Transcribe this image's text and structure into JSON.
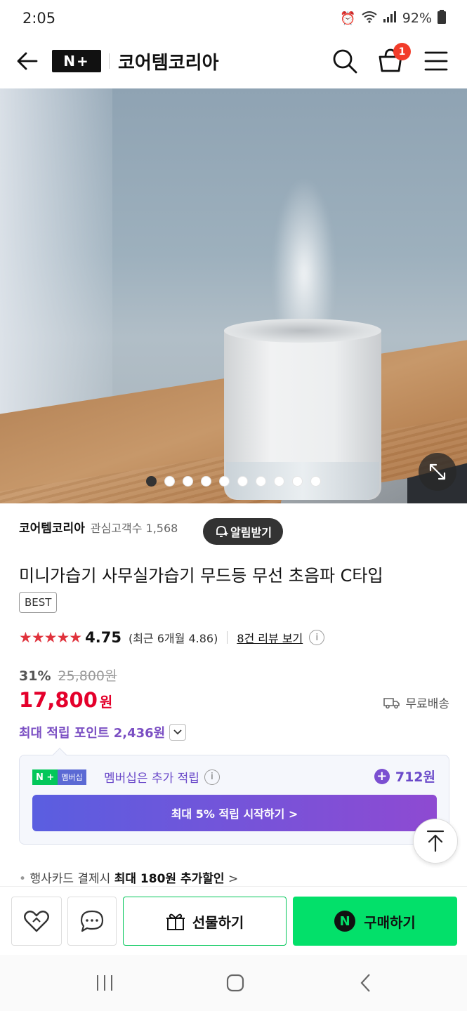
{
  "status_bar": {
    "time": "2:05",
    "battery": "92%"
  },
  "header": {
    "logo": "N+",
    "store_title": "코어템코리아",
    "cart_count": "1"
  },
  "gallery": {
    "image_count": 10,
    "active_index": 0
  },
  "store": {
    "name": "코어템코리아",
    "followers": "관심고객수 1,568",
    "alarm_label": "알림받기"
  },
  "product": {
    "title": "미니가습기 사무실가습기 무드등 무선 초음파 C타입",
    "badge": "BEST",
    "rating": {
      "stars": 4.75,
      "score": "4.75",
      "recent": "(최근 6개월 4.86)",
      "review_link": "8건 리뷰 보기"
    },
    "discount": "31%",
    "original_price": "25,800원",
    "price": "17,800",
    "price_unit": "원",
    "shipping": "무료배송",
    "points": "최대 적립 포인트 2,436원"
  },
  "membership": {
    "logo_a": "N +",
    "logo_b": "멤버십",
    "text": "멤버십은 추가 적립",
    "extra": "712원",
    "button": "최대 5% 적립 시작하기 >"
  },
  "card_promo": {
    "prefix": "행사카드 결제시 ",
    "bold": "최대 180원 추가할인",
    "suffix": " >"
  },
  "bottom_bar": {
    "gift": "선물하기",
    "buy": "구매하기",
    "buy_icon": "N"
  },
  "colors": {
    "sale_red": "#e4002b",
    "purple": "#7b4fc3",
    "naver_green": "#03c75a",
    "buy_green": "#03e06a"
  }
}
